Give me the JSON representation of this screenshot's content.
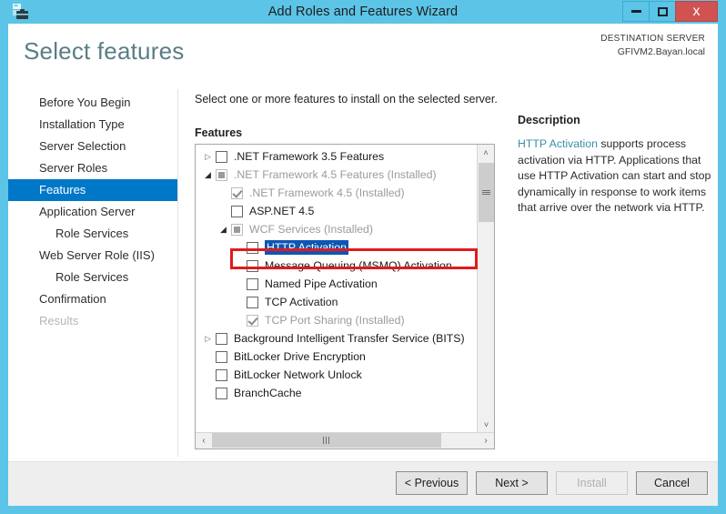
{
  "titlebar": {
    "title": "Add Roles and Features Wizard",
    "icon": "server-wizard-icon",
    "minimize_label": "–",
    "maximize_label": "□",
    "close_label": "x"
  },
  "header": {
    "page_title": "Select features",
    "destination_label": "DESTINATION SERVER",
    "destination_value": "GFIVM2.Bayan.local"
  },
  "nav": {
    "items": [
      {
        "label": "Before You Begin",
        "state": "normal",
        "indent": false
      },
      {
        "label": "Installation Type",
        "state": "normal",
        "indent": false
      },
      {
        "label": "Server Selection",
        "state": "normal",
        "indent": false
      },
      {
        "label": "Server Roles",
        "state": "normal",
        "indent": false
      },
      {
        "label": "Features",
        "state": "active",
        "indent": false
      },
      {
        "label": "Application Server",
        "state": "normal",
        "indent": false
      },
      {
        "label": "Role Services",
        "state": "normal",
        "indent": true
      },
      {
        "label": "Web Server Role (IIS)",
        "state": "normal",
        "indent": false
      },
      {
        "label": "Role Services",
        "state": "normal",
        "indent": true
      },
      {
        "label": "Confirmation",
        "state": "normal",
        "indent": false
      },
      {
        "label": "Results",
        "state": "disabled",
        "indent": false
      }
    ]
  },
  "content": {
    "instruction": "Select one or more features to install on the selected server.",
    "features_label": "Features",
    "tree": [
      {
        "label": ".NET Framework 3.5 Features",
        "level": 0,
        "expander": "collapsed",
        "checkbox": "empty",
        "dim": false,
        "selected": false
      },
      {
        "label": ".NET Framework 4.5 Features (Installed)",
        "level": 0,
        "expander": "expanded",
        "checkbox": "partial",
        "dim": true,
        "selected": false
      },
      {
        "label": ".NET Framework 4.5 (Installed)",
        "level": 1,
        "expander": "none",
        "checkbox": "checked",
        "dim": true,
        "selected": false
      },
      {
        "label": "ASP.NET 4.5",
        "level": 1,
        "expander": "none",
        "checkbox": "empty",
        "dim": false,
        "selected": false
      },
      {
        "label": "WCF Services (Installed)",
        "level": 1,
        "expander": "expanded",
        "checkbox": "partial",
        "dim": true,
        "selected": false
      },
      {
        "label": "HTTP Activation",
        "level": 2,
        "expander": "none",
        "checkbox": "empty",
        "dim": false,
        "selected": true
      },
      {
        "label": "Message Queuing (MSMQ) Activation",
        "level": 2,
        "expander": "none",
        "checkbox": "empty",
        "dim": false,
        "selected": false
      },
      {
        "label": "Named Pipe Activation",
        "level": 2,
        "expander": "none",
        "checkbox": "empty",
        "dim": false,
        "selected": false
      },
      {
        "label": "TCP Activation",
        "level": 2,
        "expander": "none",
        "checkbox": "empty",
        "dim": false,
        "selected": false
      },
      {
        "label": "TCP Port Sharing (Installed)",
        "level": 2,
        "expander": "none",
        "checkbox": "checked",
        "dim": true,
        "selected": false
      },
      {
        "label": "Background Intelligent Transfer Service (BITS)",
        "level": 0,
        "expander": "collapsed",
        "checkbox": "empty",
        "dim": false,
        "selected": false
      },
      {
        "label": "BitLocker Drive Encryption",
        "level": 0,
        "expander": "none",
        "checkbox": "empty",
        "dim": false,
        "selected": false
      },
      {
        "label": "BitLocker Network Unlock",
        "level": 0,
        "expander": "none",
        "checkbox": "empty",
        "dim": false,
        "selected": false
      },
      {
        "label": "BranchCache",
        "level": 0,
        "expander": "none",
        "checkbox": "empty",
        "dim": false,
        "selected": false
      }
    ],
    "scroll_up_glyph": "˄",
    "scroll_down_glyph": "˅",
    "scroll_left_glyph": "‹",
    "scroll_right_glyph": "›"
  },
  "description": {
    "title": "Description",
    "term": "HTTP Activation",
    "text": " supports process activation via HTTP. Applications that use HTTP Activation can start and stop dynamically in response to work items that arrive over the network via HTTP."
  },
  "footer": {
    "previous_label": "< Previous",
    "next_label": "Next >",
    "install_label": "Install",
    "cancel_label": "Cancel"
  },
  "colors": {
    "frame": "#5cc4e6",
    "accent_nav": "#0078c8",
    "selection": "#0d56b4",
    "annotation": "#e01b1b",
    "close_button": "#d05251",
    "title_heading": "#5a7d87"
  }
}
